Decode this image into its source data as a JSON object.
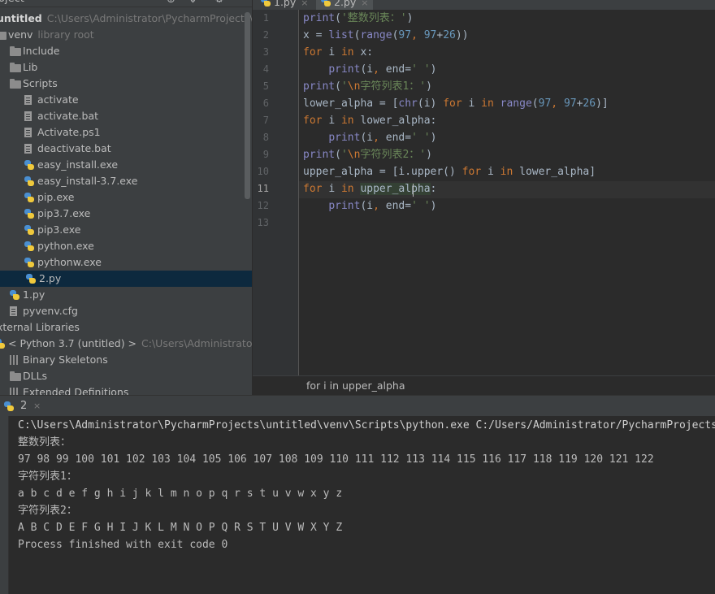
{
  "project_panel": {
    "title": "oject",
    "tree": [
      {
        "label": "untitled",
        "extra": "C:\\Users\\Administrator\\PycharmProjects\\untitled",
        "icon": "none",
        "indent": -4,
        "bold": true
      },
      {
        "label": "venv",
        "extra": "library root",
        "icon": "folder",
        "indent": 10
      },
      {
        "label": "Include",
        "extra": "",
        "icon": "folder",
        "indent": 28
      },
      {
        "label": "Lib",
        "extra": "",
        "icon": "folder",
        "indent": 28
      },
      {
        "label": "Scripts",
        "extra": "",
        "icon": "folder",
        "indent": 28
      },
      {
        "label": "activate",
        "extra": "",
        "icon": "file",
        "indent": 46
      },
      {
        "label": "activate.bat",
        "extra": "",
        "icon": "file",
        "indent": 46
      },
      {
        "label": "Activate.ps1",
        "extra": "",
        "icon": "file",
        "indent": 46
      },
      {
        "label": "deactivate.bat",
        "extra": "",
        "icon": "file",
        "indent": 46
      },
      {
        "label": "easy_install.exe",
        "extra": "",
        "icon": "py",
        "indent": 46
      },
      {
        "label": "easy_install-3.7.exe",
        "extra": "",
        "icon": "py",
        "indent": 46
      },
      {
        "label": "pip.exe",
        "extra": "",
        "icon": "py",
        "indent": 46
      },
      {
        "label": "pip3.7.exe",
        "extra": "",
        "icon": "py",
        "indent": 46
      },
      {
        "label": "pip3.exe",
        "extra": "",
        "icon": "py",
        "indent": 46
      },
      {
        "label": "python.exe",
        "extra": "",
        "icon": "py",
        "indent": 46
      },
      {
        "label": "pythonw.exe",
        "extra": "",
        "icon": "py",
        "indent": 46
      },
      {
        "label": "2.py",
        "extra": "",
        "icon": "py",
        "indent": 48,
        "selected": true
      },
      {
        "label": "1.py",
        "extra": "",
        "icon": "py",
        "indent": 28
      },
      {
        "label": "pyvenv.cfg",
        "extra": "",
        "icon": "file",
        "indent": 28
      },
      {
        "label": "xternal Libraries",
        "extra": "",
        "icon": "none",
        "indent": -4
      },
      {
        "label": "< Python 3.7 (untitled) >",
        "extra": "C:\\Users\\Administrator\\Pyc",
        "icon": "py",
        "indent": 10
      },
      {
        "label": "Binary Skeletons",
        "extra": "",
        "icon": "lib",
        "indent": 28
      },
      {
        "label": "DLLs",
        "extra": "",
        "icon": "folder",
        "indent": 28
      },
      {
        "label": "Extended Definitions",
        "extra": "",
        "icon": "lib",
        "indent": 28
      }
    ]
  },
  "editor": {
    "tabs": [
      {
        "label": "1.py",
        "active": false
      },
      {
        "label": "2.py",
        "active": true
      }
    ],
    "line_numbers": [
      "1",
      "2",
      "3",
      "4",
      "5",
      "6",
      "7",
      "8",
      "9",
      "10",
      "11",
      "12",
      "13"
    ],
    "current_line": 11,
    "code_lines": [
      [
        {
          "t": "print",
          "c": "bi"
        },
        {
          "t": "(",
          "c": ""
        },
        {
          "t": "'整数列表：'",
          "c": "str"
        },
        {
          "t": ")",
          "c": ""
        }
      ],
      [
        {
          "t": "x = ",
          "c": ""
        },
        {
          "t": "list",
          "c": "bi"
        },
        {
          "t": "(",
          "c": ""
        },
        {
          "t": "range",
          "c": "bi"
        },
        {
          "t": "(",
          "c": ""
        },
        {
          "t": "97",
          "c": "num"
        },
        {
          "t": ", ",
          "c": "kw"
        },
        {
          "t": "97",
          "c": "num"
        },
        {
          "t": "+",
          "c": ""
        },
        {
          "t": "26",
          "c": "num"
        },
        {
          "t": "))",
          "c": ""
        }
      ],
      [
        {
          "t": "for ",
          "c": "kw"
        },
        {
          "t": "i ",
          "c": ""
        },
        {
          "t": "in ",
          "c": "kw"
        },
        {
          "t": "x:",
          "c": ""
        }
      ],
      [
        {
          "t": "    ",
          "c": ""
        },
        {
          "t": "print",
          "c": "bi"
        },
        {
          "t": "(i",
          "c": ""
        },
        {
          "t": ", ",
          "c": "kw"
        },
        {
          "t": "end=",
          "c": ""
        },
        {
          "t": "' '",
          "c": "str"
        },
        {
          "t": ")",
          "c": ""
        }
      ],
      [
        {
          "t": "print",
          "c": "bi"
        },
        {
          "t": "(",
          "c": ""
        },
        {
          "t": "'",
          "c": "str"
        },
        {
          "t": "\\n",
          "c": "esc"
        },
        {
          "t": "字符列表1：'",
          "c": "str"
        },
        {
          "t": ")",
          "c": ""
        }
      ],
      [
        {
          "t": "lower_alpha = [",
          "c": ""
        },
        {
          "t": "chr",
          "c": "bi"
        },
        {
          "t": "(i) ",
          "c": ""
        },
        {
          "t": "for ",
          "c": "kw"
        },
        {
          "t": "i ",
          "c": ""
        },
        {
          "t": "in ",
          "c": "kw"
        },
        {
          "t": "range",
          "c": "bi"
        },
        {
          "t": "(",
          "c": ""
        },
        {
          "t": "97",
          "c": "num"
        },
        {
          "t": ", ",
          "c": "kw"
        },
        {
          "t": "97",
          "c": "num"
        },
        {
          "t": "+",
          "c": ""
        },
        {
          "t": "26",
          "c": "num"
        },
        {
          "t": ")]",
          "c": ""
        }
      ],
      [
        {
          "t": "for ",
          "c": "kw"
        },
        {
          "t": "i ",
          "c": ""
        },
        {
          "t": "in ",
          "c": "kw"
        },
        {
          "t": "lower_alpha:",
          "c": ""
        }
      ],
      [
        {
          "t": "    ",
          "c": ""
        },
        {
          "t": "print",
          "c": "bi"
        },
        {
          "t": "(i",
          "c": ""
        },
        {
          "t": ", ",
          "c": "kw"
        },
        {
          "t": "end=",
          "c": ""
        },
        {
          "t": "' '",
          "c": "str"
        },
        {
          "t": ")",
          "c": ""
        }
      ],
      [
        {
          "t": "print",
          "c": "bi"
        },
        {
          "t": "(",
          "c": ""
        },
        {
          "t": "'",
          "c": "str"
        },
        {
          "t": "\\n",
          "c": "esc"
        },
        {
          "t": "字符列表2：'",
          "c": "str"
        },
        {
          "t": ")",
          "c": ""
        }
      ],
      [
        {
          "t": "upper_alpha = [i.upper() ",
          "c": ""
        },
        {
          "t": "for ",
          "c": "kw"
        },
        {
          "t": "i ",
          "c": ""
        },
        {
          "t": "in ",
          "c": "kw"
        },
        {
          "t": "lower_alpha]",
          "c": ""
        }
      ],
      [
        {
          "t": "for ",
          "c": "kw"
        },
        {
          "t": "i ",
          "c": ""
        },
        {
          "t": "in ",
          "c": "kw"
        },
        {
          "t": "upper_alpha",
          "c": "hl"
        },
        {
          "t": ":",
          "c": ""
        }
      ],
      [
        {
          "t": "    ",
          "c": ""
        },
        {
          "t": "print",
          "c": "bi"
        },
        {
          "t": "(i",
          "c": ""
        },
        {
          "t": ", ",
          "c": "kw"
        },
        {
          "t": "end=",
          "c": ""
        },
        {
          "t": "' '",
          "c": "str"
        },
        {
          "t": ")",
          "c": ""
        }
      ],
      []
    ],
    "breadcrumb": "for i in upper_alpha"
  },
  "run_panel": {
    "tab_label": "2",
    "close_glyph": "×",
    "console_lines": [
      "C:\\Users\\Administrator\\PycharmProjects\\untitled\\venv\\Scripts\\python.exe C:/Users/Administrator/PycharmProjects/untitled/2.py",
      "整数列表：",
      "97 98 99 100 101 102 103 104 105 106 107 108 109 110 111 112 113 114 115 116 117 118 119 120 121 122",
      "字符列表1：",
      "a b c d e f g h i j k l m n o p q r s t u v w x y z",
      "字符列表2：",
      "A B C D E F G H I J K L M N O P Q R S T U V W X Y Z",
      "Process finished with exit code 0"
    ]
  },
  "colors": {
    "keyword": "#cc7832",
    "builtin": "#8888c6",
    "string": "#6a8759",
    "number": "#6897bb",
    "selection": "#0d293e"
  }
}
